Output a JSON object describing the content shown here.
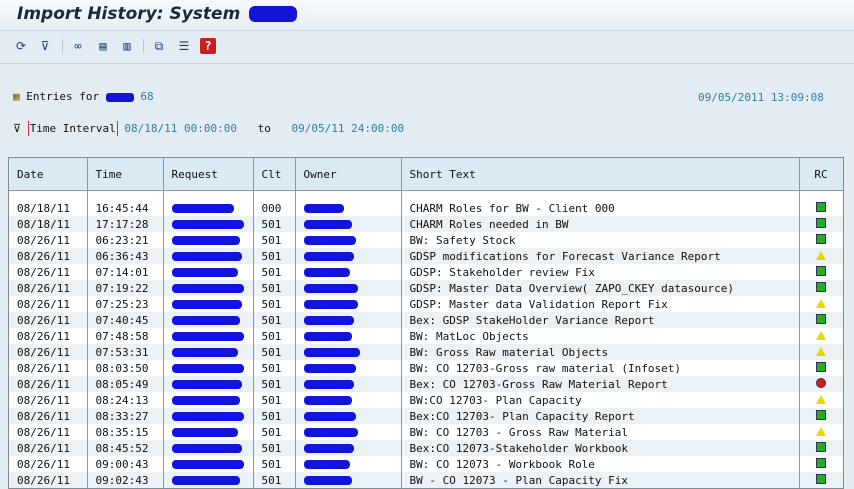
{
  "window": {
    "title": "Import History: System"
  },
  "toolbar": {
    "icons": [
      "refresh-icon",
      "filter-icon",
      "glasses-icon",
      "detail-list-icon",
      "document-icon",
      "export-icon",
      "legend-icon",
      "help-icon"
    ]
  },
  "header": {
    "entries_label": "Entries for",
    "entries_count": "68",
    "timestamp": "09/05/2011 13:09:08",
    "time_interval_label": "Time Interval",
    "interval_from": "08/18/11 00:00:00",
    "interval_to_label": "to",
    "interval_to": "09/05/11 24:00:00"
  },
  "table": {
    "columns": [
      "Date",
      "Time",
      "Request",
      "Clt",
      "Owner",
      "Short Text",
      "RC"
    ],
    "rows": [
      {
        "date": "08/18/11",
        "time": "16:45:44",
        "clt": "000",
        "text": "CHARM Roles for BW - Client 000",
        "rc": "green"
      },
      {
        "date": "08/18/11",
        "time": "17:17:28",
        "clt": "501",
        "text": "CHARM Roles needed in BW",
        "rc": "green"
      },
      {
        "date": "08/26/11",
        "time": "06:23:21",
        "clt": "501",
        "text": "BW: Safety Stock",
        "rc": "green"
      },
      {
        "date": "08/26/11",
        "time": "06:36:43",
        "clt": "501",
        "text": "GDSP modifications for Forecast Variance Report",
        "rc": "yellow"
      },
      {
        "date": "08/26/11",
        "time": "07:14:01",
        "clt": "501",
        "text": "GDSP: Stakeholder review Fix",
        "rc": "green"
      },
      {
        "date": "08/26/11",
        "time": "07:19:22",
        "clt": "501",
        "text": "GDSP: Master Data Overview( ZAPO_CKEY datasource)",
        "rc": "green"
      },
      {
        "date": "08/26/11",
        "time": "07:25:23",
        "clt": "501",
        "text": "GDSP: Master data Validation Report Fix",
        "rc": "yellow"
      },
      {
        "date": "08/26/11",
        "time": "07:40:45",
        "clt": "501",
        "text": "Bex: GDSP StakeHolder Variance Report",
        "rc": "green"
      },
      {
        "date": "08/26/11",
        "time": "07:48:58",
        "clt": "501",
        "text": "BW: MatLoc Objects",
        "rc": "yellow"
      },
      {
        "date": "08/26/11",
        "time": "07:53:31",
        "clt": "501",
        "text": "BW: Gross Raw material Objects",
        "rc": "yellow"
      },
      {
        "date": "08/26/11",
        "time": "08:03:50",
        "clt": "501",
        "text": "BW: CO 12703-Gross raw material (Infoset)",
        "rc": "green"
      },
      {
        "date": "08/26/11",
        "time": "08:05:49",
        "clt": "501",
        "text": "Bex: CO 12703-Gross Raw Material Report",
        "rc": "red"
      },
      {
        "date": "08/26/11",
        "time": "08:24:13",
        "clt": "501",
        "text": "BW:CO 12703- Plan Capacity",
        "rc": "yellow"
      },
      {
        "date": "08/26/11",
        "time": "08:33:27",
        "clt": "501",
        "text": "Bex:CO 12703- Plan Capacity Report",
        "rc": "green"
      },
      {
        "date": "08/26/11",
        "time": "08:35:15",
        "clt": "501",
        "text": "BW: CO 12703 - Gross Raw Material",
        "rc": "yellow"
      },
      {
        "date": "08/26/11",
        "time": "08:45:52",
        "clt": "501",
        "text": "Bex:CO 12073-Stakeholder Workbook",
        "rc": "green"
      },
      {
        "date": "08/26/11",
        "time": "09:00:43",
        "clt": "501",
        "text": "BW: CO 12073 - Workbook Role",
        "rc": "green"
      },
      {
        "date": "08/26/11",
        "time": "09:02:43",
        "clt": "501",
        "text": "BW - CO 12073 - Plan Capacity Fix",
        "rc": "green"
      }
    ]
  }
}
